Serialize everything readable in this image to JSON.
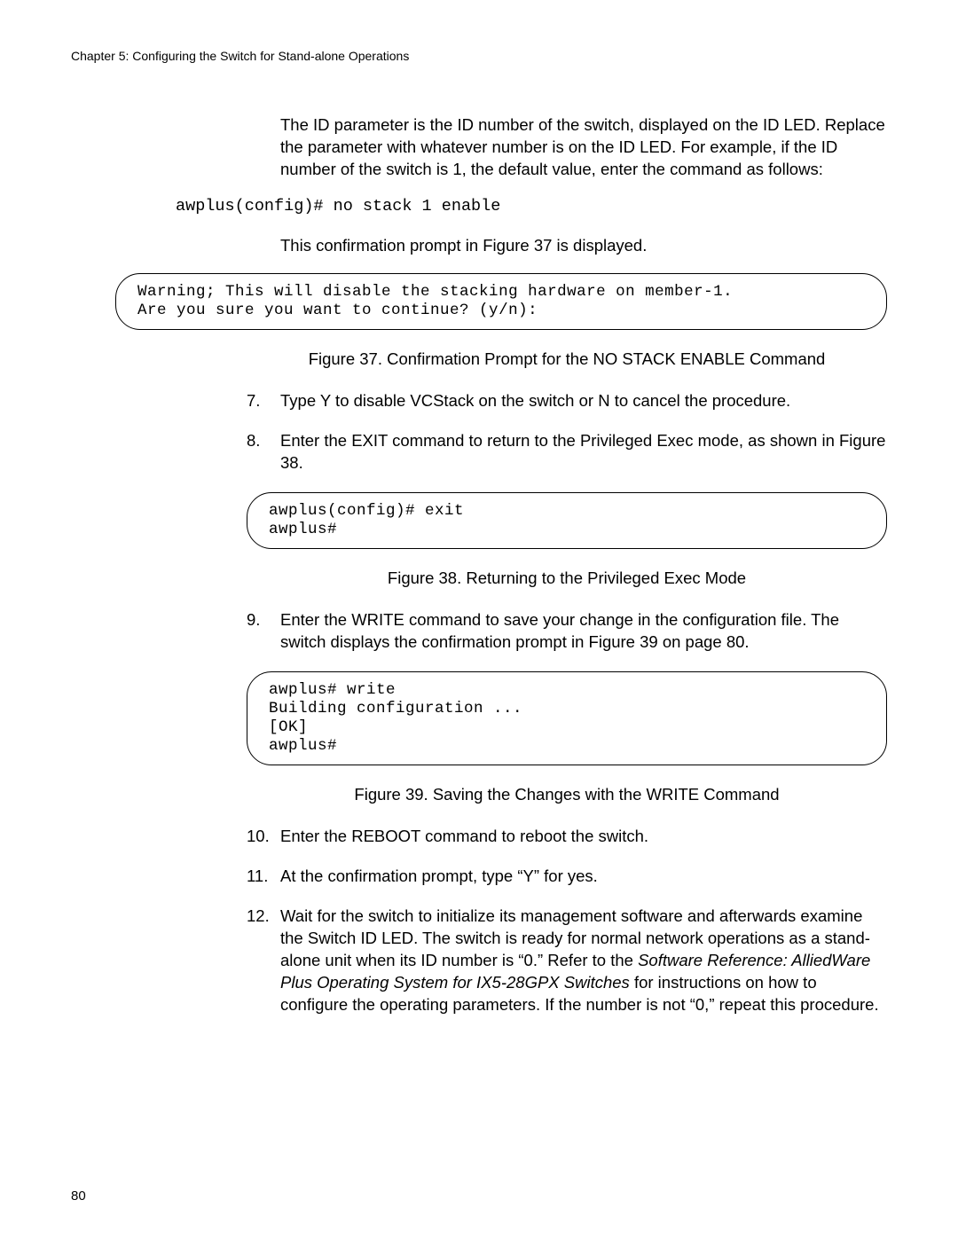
{
  "header": "Chapter 5: Configuring the Switch for Stand-alone Operations",
  "para1": "The ID parameter is the ID number of the switch, displayed on the ID LED. Replace the parameter with whatever number is on the ID LED. For example, if the ID number of the switch is 1, the default value, enter the command as follows:",
  "codeLine1": "awplus(config)# no stack 1 enable",
  "para2": "This confirmation prompt in Figure 37 is displayed.",
  "codeBox1": "Warning; This will disable the stacking hardware on member-1.\nAre you sure you want to continue? (y/n):",
  "figCaption37": "Figure 37. Confirmation Prompt for the NO STACK ENABLE Command",
  "step7": {
    "num": "7.",
    "text": "Type Y to disable VCStack on the switch or N to cancel the procedure."
  },
  "step8": {
    "num": "8.",
    "text": "Enter the EXIT command to return to the Privileged Exec mode, as shown in Figure 38."
  },
  "codeBox2": "awplus(config)# exit\nawplus#",
  "figCaption38": "Figure 38. Returning to the Privileged Exec Mode",
  "step9": {
    "num": "9.",
    "text": "Enter the WRITE command to save your change in the configuration file. The switch displays the confirmation prompt in Figure 39 on page 80."
  },
  "codeBox3": "awplus# write\nBuilding configuration ...\n[OK]\nawplus#",
  "figCaption39": "Figure 39. Saving the Changes with the WRITE Command",
  "step10": {
    "num": "10.",
    "text": "Enter the REBOOT command to reboot the switch."
  },
  "step11": {
    "num": "11.",
    "text": "At the confirmation prompt, type “Y” for yes."
  },
  "step12": {
    "num": "12.",
    "textPart1": "Wait for the switch to initialize its management software and afterwards examine the Switch ID LED. The switch is ready for normal network operations as a stand-alone unit when its ID number is “0.” Refer to the ",
    "italic": "Software Reference: AlliedWare Plus Operating System for IX5-28GPX Switches",
    "textPart2": " for instructions on how to configure the operating parameters. If the number is not “0,” repeat this procedure."
  },
  "pageNumber": "80"
}
